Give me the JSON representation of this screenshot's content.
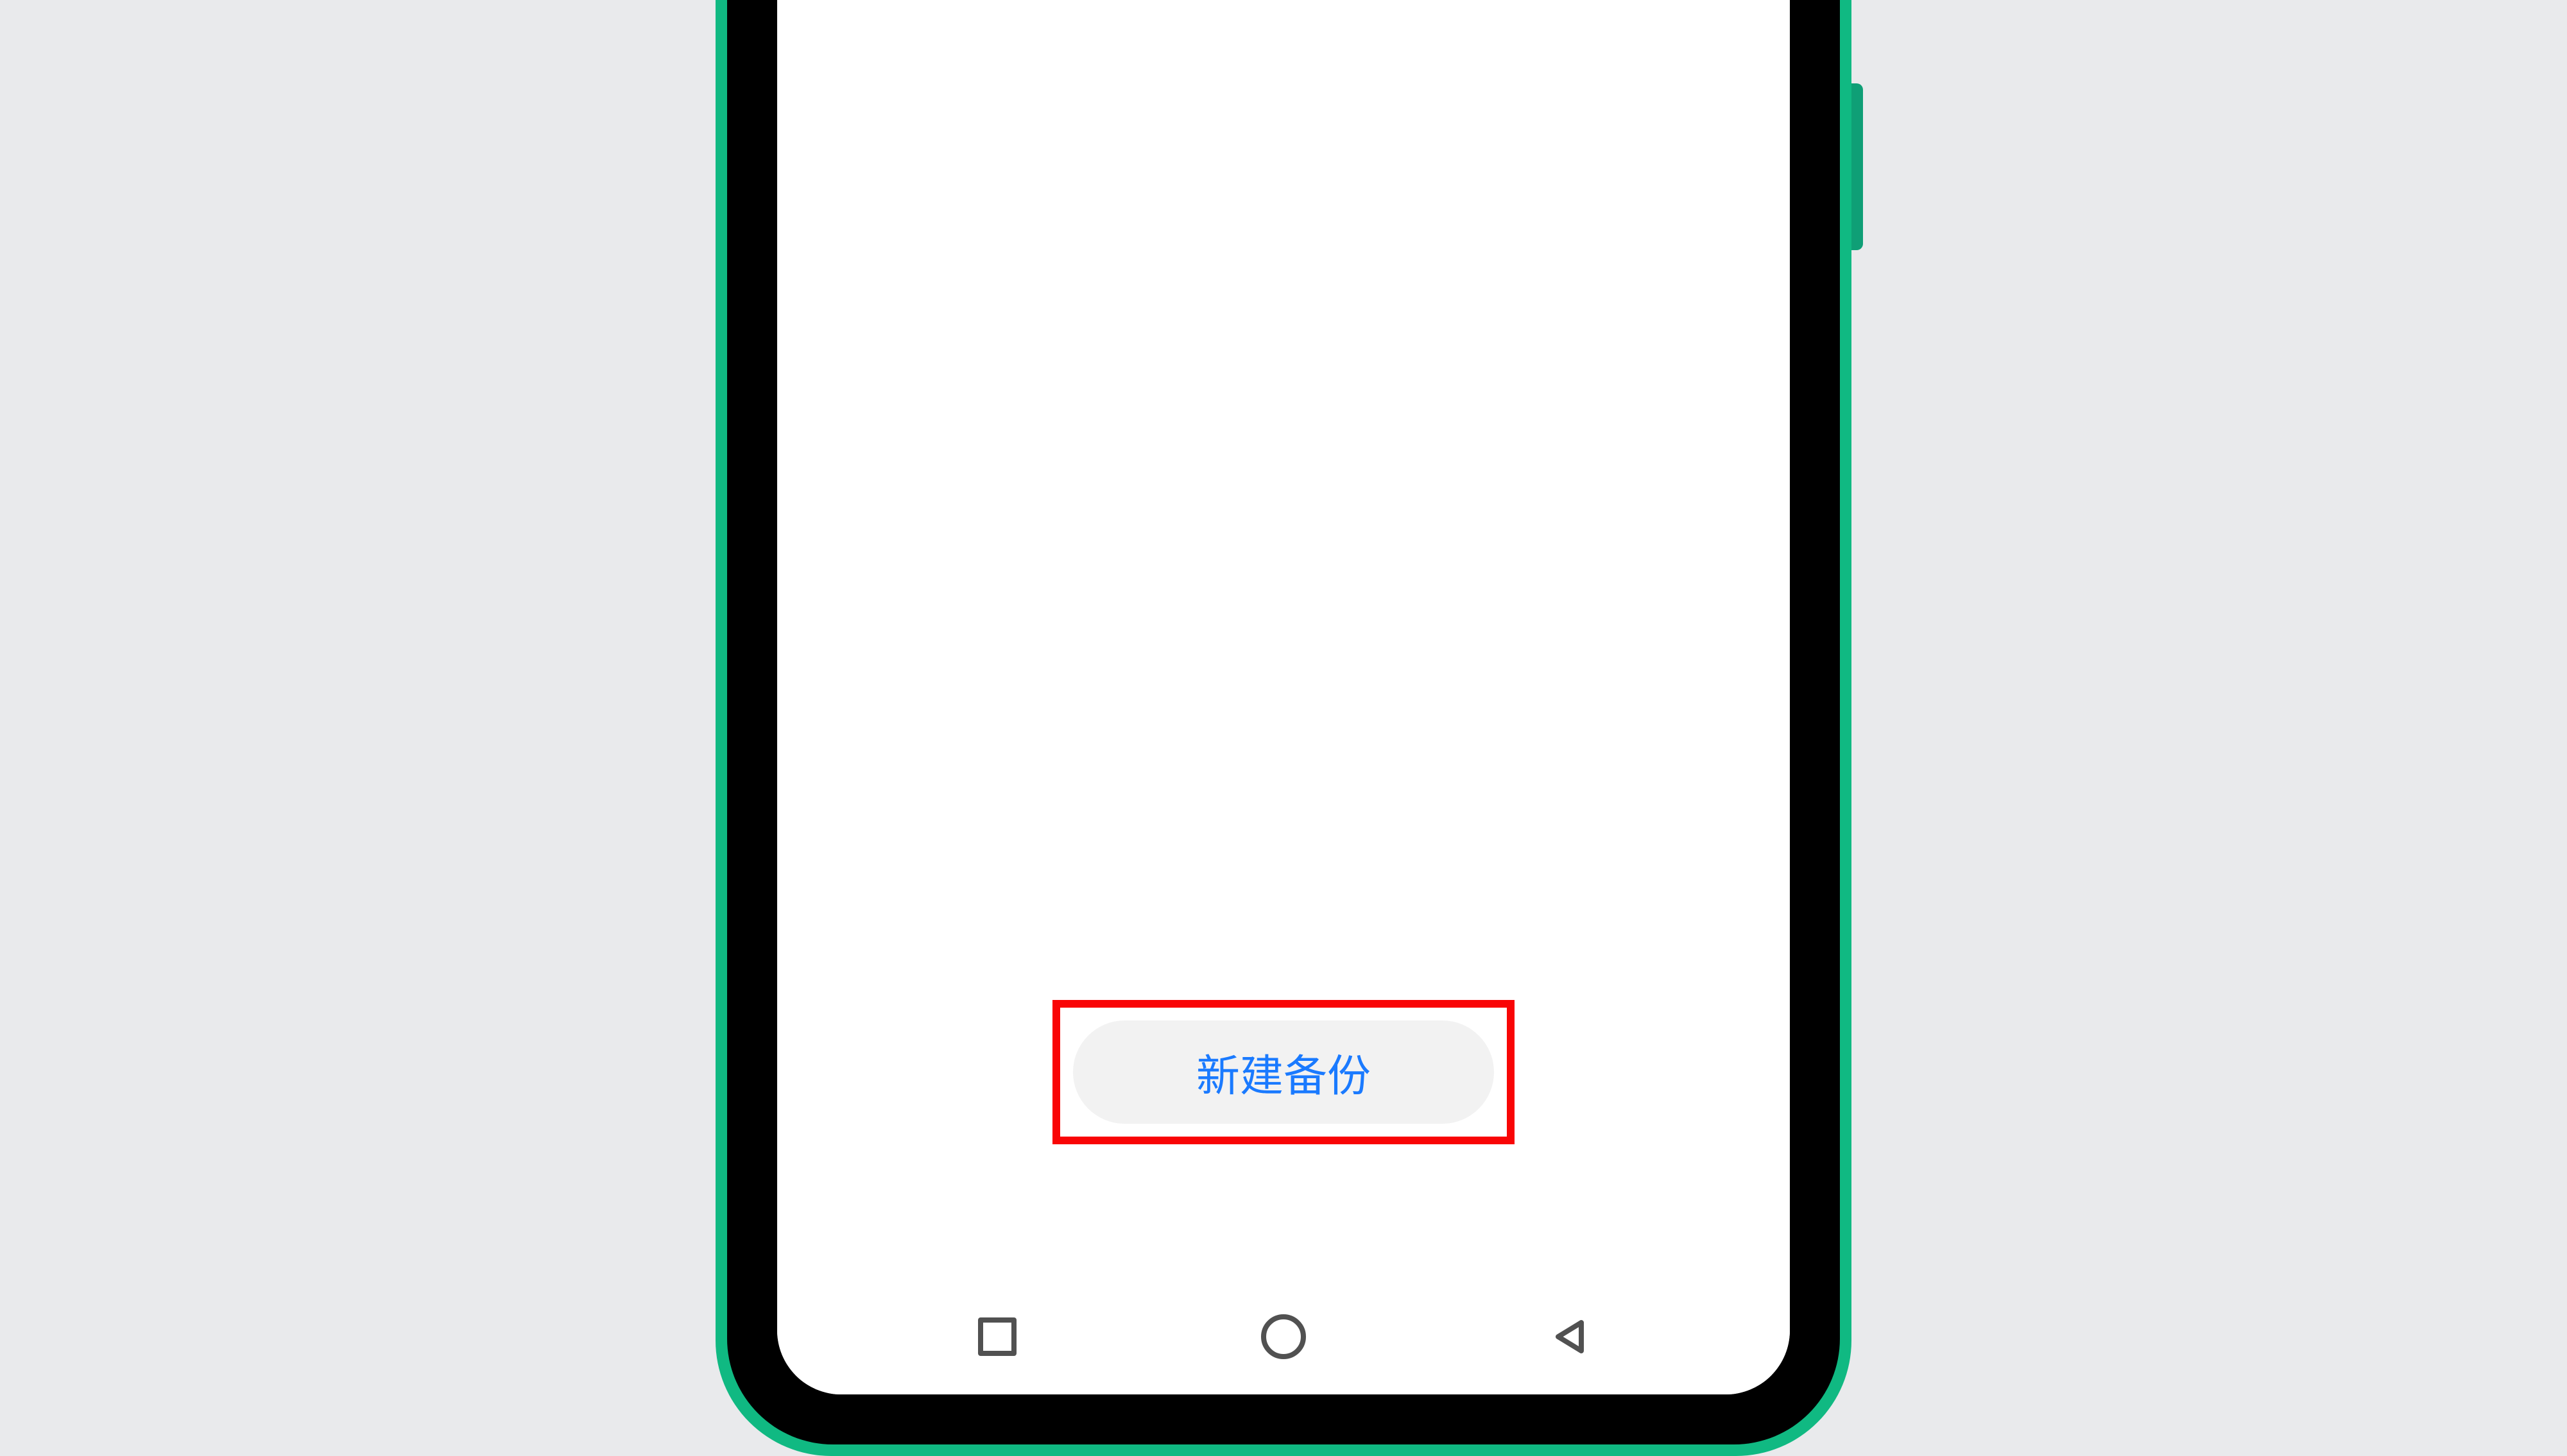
{
  "app": {
    "new_backup_button_label": "新建备份"
  },
  "colors": {
    "highlight_border": "#f90506",
    "button_text": "#1a7aff",
    "button_bg": "#f2f2f2",
    "frame_green": "#10b982",
    "nav_icon": "#515151",
    "background": "#e9eaec"
  }
}
